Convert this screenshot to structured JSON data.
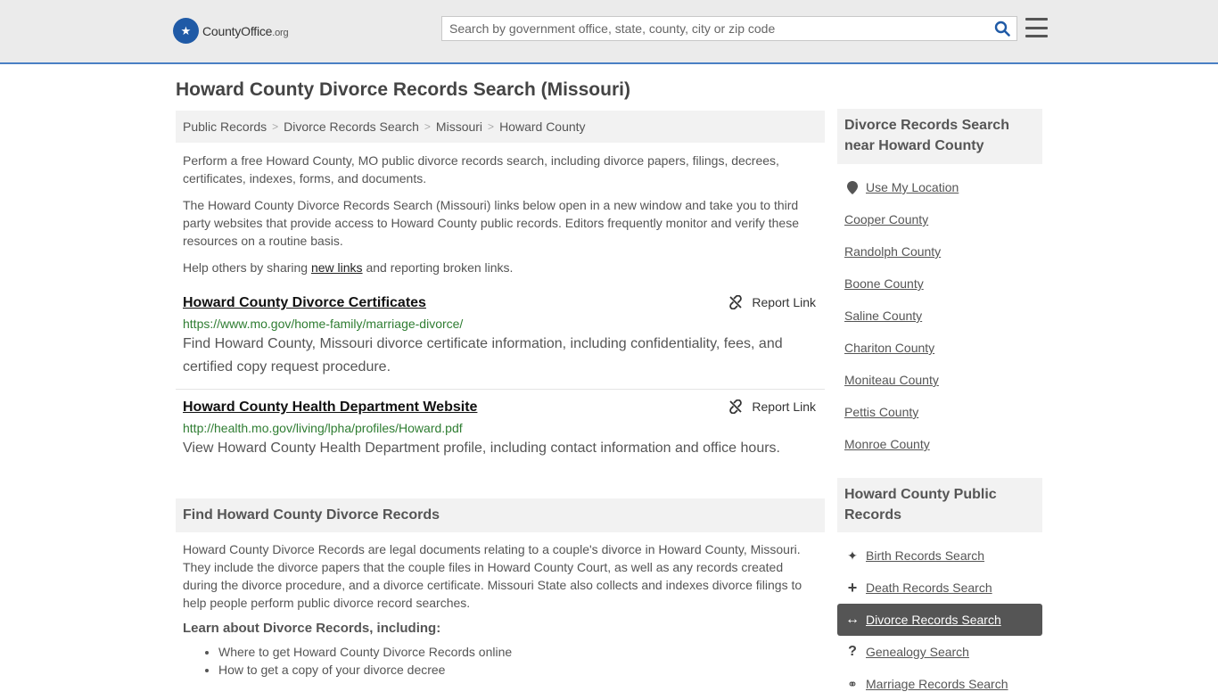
{
  "header": {
    "logo_main": "CountyOffice",
    "logo_tld": ".org",
    "search_placeholder": "Search by government office, state, county, city or zip code"
  },
  "page_title": "Howard County Divorce Records Search (Missouri)",
  "breadcrumb": [
    "Public Records",
    "Divorce Records Search",
    "Missouri",
    "Howard County"
  ],
  "intro": {
    "p1": "Perform a free Howard County, MO public divorce records search, including divorce papers, filings, decrees, certificates, indexes, forms, and documents.",
    "p2": "The Howard County Divorce Records Search (Missouri) links below open in a new window and take you to third party websites that provide access to Howard County public records. Editors frequently monitor and verify these resources on a routine basis.",
    "p3_before": "Help others by sharing ",
    "p3_link": "new links",
    "p3_after": " and reporting broken links."
  },
  "links": [
    {
      "title": "Howard County Divorce Certificates",
      "url": "https://www.mo.gov/home-family/marriage-divorce/",
      "description": "Find Howard County, Missouri divorce certificate information, including confidentiality, fees, and certified copy request procedure.",
      "report": "Report Link"
    },
    {
      "title": "Howard County Health Department Website",
      "url": "http://health.mo.gov/living/lpha/profiles/Howard.pdf",
      "description": "View Howard County Health Department profile, including contact information and office hours.",
      "report": "Report Link"
    }
  ],
  "find_section": {
    "heading": "Find Howard County Divorce Records",
    "body": "Howard County Divorce Records are legal documents relating to a couple's divorce in Howard County, Missouri. They include the divorce papers that the couple files in Howard County Court, as well as any records created during the divorce procedure, and a divorce certificate. Missouri State also collects and indexes divorce filings to help people perform public divorce record searches.",
    "learn_heading": "Learn about Divorce Records, including:",
    "learn_items": [
      "Where to get Howard County Divorce Records online",
      "How to get a copy of your divorce decree"
    ]
  },
  "sidebar": {
    "nearby_heading": "Divorce Records Search near Howard County",
    "use_location": "Use My Location",
    "nearby": [
      "Cooper County",
      "Randolph County",
      "Boone County",
      "Saline County",
      "Chariton County",
      "Moniteau County",
      "Pettis County",
      "Monroe County"
    ],
    "public_heading": "Howard County Public Records",
    "public_items": [
      {
        "label": "Birth Records Search",
        "icon": "baby-icon"
      },
      {
        "label": "Death Records Search",
        "icon": "cross-icon"
      },
      {
        "label": "Divorce Records Search",
        "icon": "arrows-icon",
        "active": true
      },
      {
        "label": "Genealogy Search",
        "icon": "question-icon"
      },
      {
        "label": "Marriage Records Search",
        "icon": "rings-icon"
      }
    ]
  },
  "colors": {
    "accent": "#4a80c4",
    "link_green": "#2f7d32",
    "active_bg": "#555555"
  }
}
